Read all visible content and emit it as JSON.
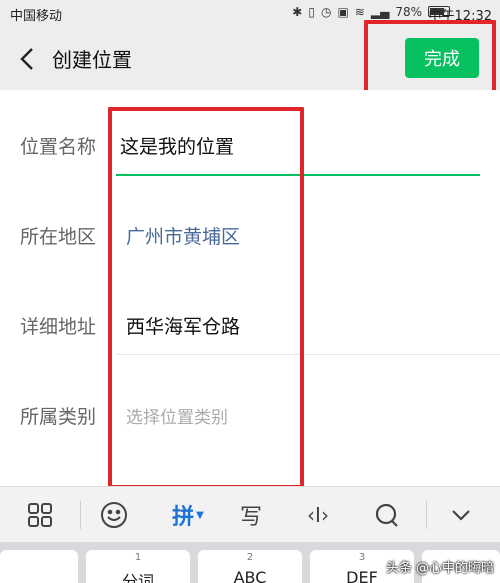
{
  "status_bar": {
    "carrier": "中国移动",
    "battery": "78%",
    "time": "中午12:32",
    "icons": [
      "bluetooth-icon",
      "vibrate-icon",
      "alarm-icon",
      "hd-icon",
      "wifi-icon",
      "signal-icon",
      "battery-icon"
    ]
  },
  "header": {
    "title": "创建位置",
    "done_label": "完成",
    "accent_color": "#07c160"
  },
  "form": {
    "rows": [
      {
        "label": "位置名称",
        "value": "这是我的位置"
      },
      {
        "label": "所在地区",
        "value": "广州市黄埔区"
      },
      {
        "label": "详细地址",
        "value": "西华海军仓路"
      },
      {
        "label": "所属类别",
        "placeholder": "选择位置类别"
      }
    ]
  },
  "keyboard": {
    "toolbar": {
      "pinyin_label": "拼",
      "handwrite_label": "写",
      "cursor_label": "‹I›"
    },
    "keys": [
      {
        "num": "",
        "label": ""
      },
      {
        "num": "1",
        "label": "分词"
      },
      {
        "num": "2",
        "label": "ABC"
      },
      {
        "num": "3",
        "label": "DEF"
      },
      {
        "num": "",
        "label": ""
      }
    ]
  },
  "watermark": "头条 @心中的晦暗",
  "annotation_color": "#e0262b"
}
